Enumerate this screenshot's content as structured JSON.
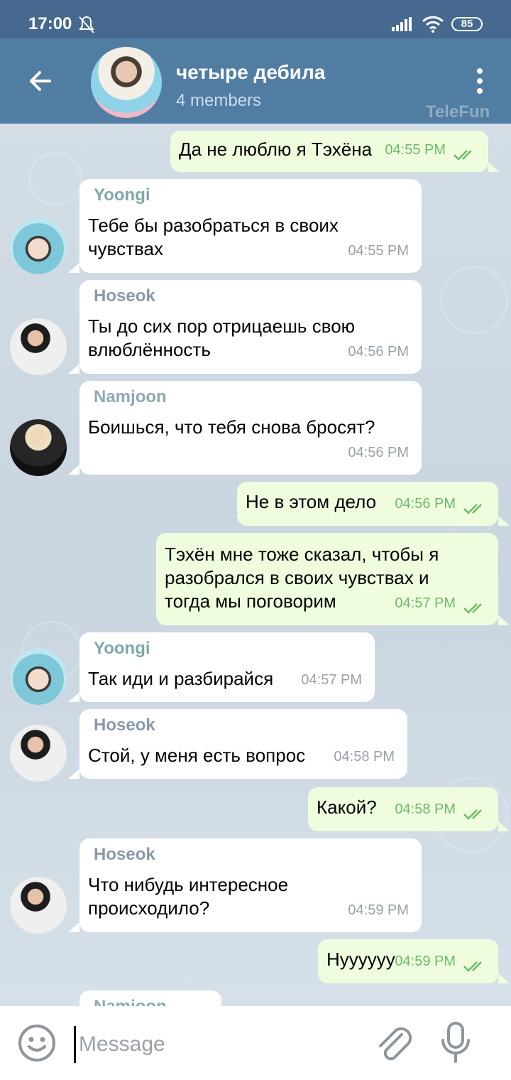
{
  "status": {
    "time": "17:00",
    "battery": "85"
  },
  "header": {
    "title": "четыре дебила",
    "subtitle": "4 members",
    "watermark": "TeleFun"
  },
  "colors": {
    "header": "#527da3",
    "status_bar": "#47698f",
    "outgoing": "#effdde",
    "incoming": "#ffffff",
    "check": "#6dbb6b"
  },
  "senders": {
    "yoongi": {
      "name": "Yoongi",
      "color": "#7fa8a8"
    },
    "hoseok": {
      "name": "Hoseok",
      "color": "#8b98a9"
    },
    "namjoon": {
      "name": "Namjoon",
      "color": "#8fa9b2"
    }
  },
  "messages": [
    {
      "dir": "out",
      "text": "Да не люблю я Тэхёна",
      "time": "04:55 PM"
    },
    {
      "dir": "in",
      "sender": "Yoongi",
      "text": "Тебе бы разобраться в своих чувствах",
      "time": "04:55 PM"
    },
    {
      "dir": "in",
      "sender": "Hoseok",
      "text": "Ты до сих пор отрицаешь свою влюблённость",
      "time": "04:56 PM"
    },
    {
      "dir": "in",
      "sender": "Namjoon",
      "text": "Боишься, что тебя снова бросят?",
      "time": "04:56 PM"
    },
    {
      "dir": "out",
      "text": "Не в этом дело",
      "time": "04:56 PM"
    },
    {
      "dir": "out",
      "text": "Тэхён мне тоже сказал, чтобы я разобрался в своих чувствах и тогда мы поговорим",
      "time": "04:57 PM"
    },
    {
      "dir": "in",
      "sender": "Yoongi",
      "text": "Так иди и разбирайся",
      "time": "04:57 PM"
    },
    {
      "dir": "in",
      "sender": "Hoseok",
      "text": "Стой, у меня есть вопрос",
      "time": "04:58 PM"
    },
    {
      "dir": "out",
      "text": "Какой?",
      "time": "04:58 PM"
    },
    {
      "dir": "in",
      "sender": "Hoseok",
      "text": "Что нибудь интересное происходило?",
      "time": "04:59 PM"
    },
    {
      "dir": "out",
      "text": "Нуууууу",
      "time": "04:59 PM"
    },
    {
      "dir": "in",
      "sender": "Namjoon",
      "text": "",
      "time": ""
    }
  ],
  "input": {
    "placeholder": "Message"
  },
  "icons": {
    "back": "back-arrow-icon",
    "menu": "more-vert-icon",
    "emoji": "emoji-icon",
    "attach": "paperclip-icon",
    "mic": "microphone-icon",
    "bell": "bell-off-icon",
    "signal": "signal-icon",
    "wifi": "wifi-icon"
  }
}
